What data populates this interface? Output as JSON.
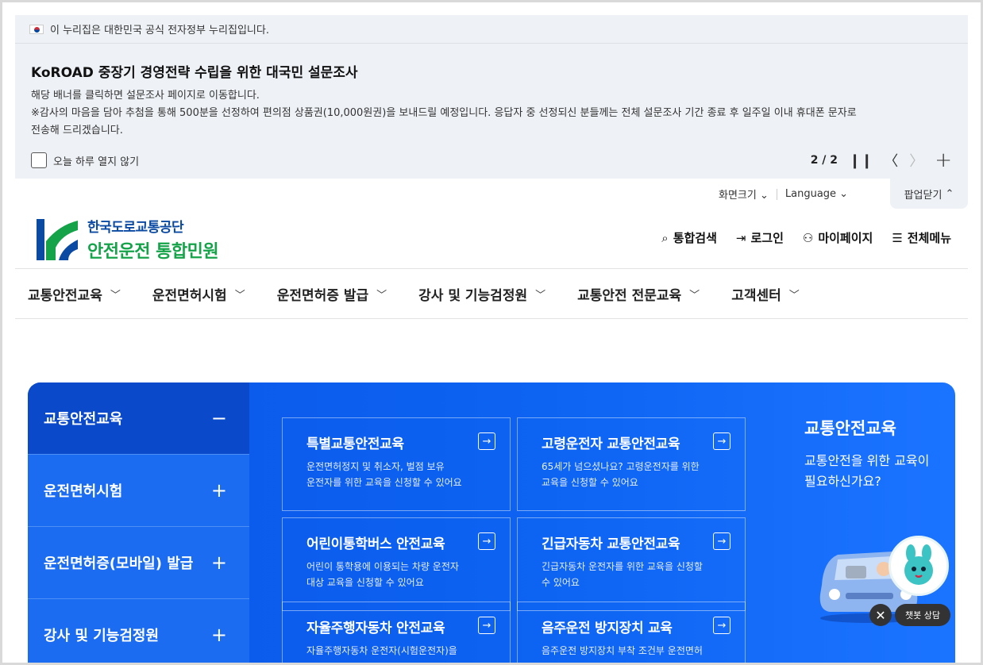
{
  "gov_bar": {
    "text": "이 누리집은 대한민국 공식 전자정부 누리집입니다."
  },
  "banner": {
    "title": "KoROAD 중장기 경영전략 수립을 위한 대국민 설문조사",
    "line1": "해당 배너를 클릭하면 설문조사 페이지로 이동합니다.",
    "line2": "※감사의 마음을 담아 추첨을 통해 500분을 선정하여 편의점 상품권(10,000원권)을 보내드릴 예정입니다. 응답자 중 선정되신 분들께는 전체 설문조사 기간 종료 후 일주일 이내 휴대폰 문자로",
    "line3": "전송해 드리겠습니다.",
    "checkbox_label": "오늘 하루 열지 않기",
    "pager": "2 / 2"
  },
  "util": {
    "screen_size": "화면크기",
    "language": "Language",
    "popup_close": "팝업닫기"
  },
  "logo": {
    "top": "한국도로교통공단",
    "bottom": "안전운전 통합민원"
  },
  "header_nav": [
    {
      "label": "통합검색",
      "icon": "search-icon"
    },
    {
      "label": "로그인",
      "icon": "login-icon"
    },
    {
      "label": "마이페이지",
      "icon": "user-icon"
    },
    {
      "label": "전체메뉴",
      "icon": "menu-icon"
    }
  ],
  "main_nav": [
    "교통안전교육",
    "운전면허시험",
    "운전면허증 발급",
    "강사 및 기능검정원",
    "교통안전 전문교육",
    "고객센터"
  ],
  "side_menu": [
    {
      "label": "교통안전교육",
      "state": "−"
    },
    {
      "label": "운전면허시험",
      "state": "+"
    },
    {
      "label": "운전면허증(모바일) 발급",
      "state": "+"
    },
    {
      "label": "강사 및 기능검정원",
      "state": "+"
    }
  ],
  "cards": [
    {
      "title": "특별교통안전교육",
      "desc1": "운전면허정지 및 취소자, 벌점 보유",
      "desc2": "운전자를 위한 교육을 신청할 수 있어요"
    },
    {
      "title": "고령운전자 교통안전교육",
      "desc1": "65세가 넘으셨나요? 고령운전자를 위한",
      "desc2": "교육을 신청할 수 있어요"
    },
    {
      "title": "어린이통학버스 안전교육",
      "desc1": "어린이 통학용에 이용되는 차량 운전자",
      "desc2": "대상 교육을 신청할 수 있어요"
    },
    {
      "title": "긴급자동차 교통안전교육",
      "desc1": "긴급자동차 운전자를 위한 교육을 신청할",
      "desc2": "수 있어요"
    },
    {
      "title": "자율주행자동차 안전교육",
      "desc1": "자율주행자동차 운전자(시험운전자)을",
      "desc2": ""
    },
    {
      "title": "음주운전 방지장치 교육",
      "desc1": "음주운전 방지장치 부착 조건부 운전면허",
      "desc2": ""
    }
  ],
  "intro": {
    "title": "교통안전교육",
    "line1": "교통안전을 위한 교육이",
    "line2": "필요하신가요?"
  },
  "chatbot": {
    "label": "챗봇 상담"
  },
  "colors": {
    "brand_blue": "#0d63f2",
    "logo_green": "#15a34a",
    "logo_navy": "#0b4aa2"
  }
}
